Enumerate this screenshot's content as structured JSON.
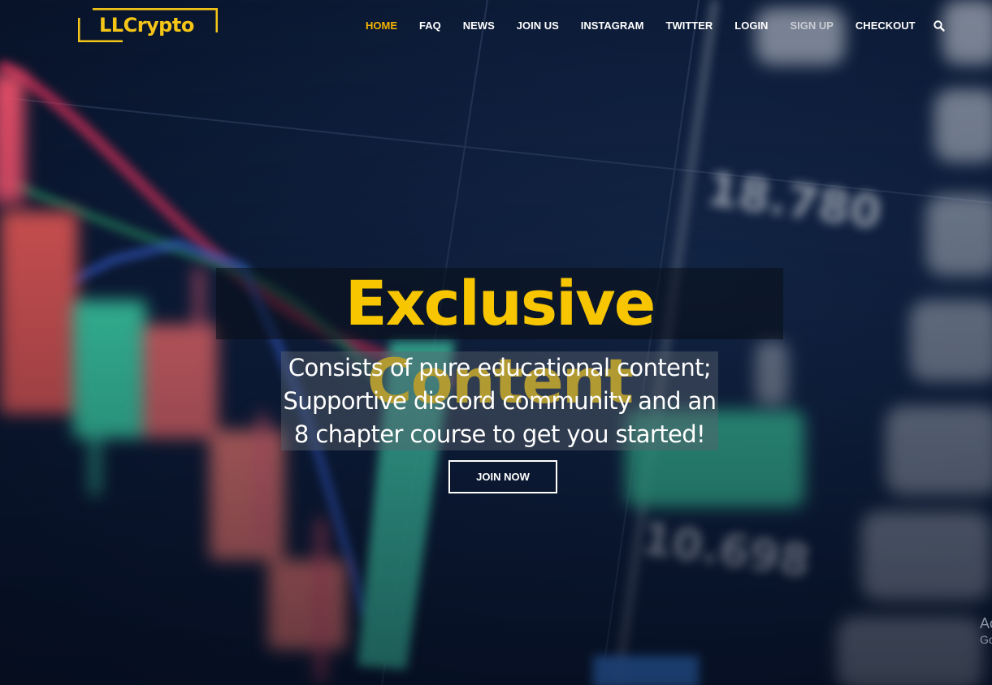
{
  "brand": {
    "logo_text": "LLCrypto",
    "accent_color": "#f5c518"
  },
  "nav": {
    "items": [
      {
        "label": "HOME",
        "active": true
      },
      {
        "label": "FAQ",
        "active": false
      },
      {
        "label": "NEWS",
        "active": false
      },
      {
        "label": "JOIN US",
        "active": false
      },
      {
        "label": "INSTAGRAM",
        "active": false
      },
      {
        "label": "TWITTER",
        "active": false
      },
      {
        "label": "LOGIN",
        "active": false
      },
      {
        "label": "SIGN UP",
        "active": false
      },
      {
        "label": "CHECKOUT",
        "active": false
      }
    ],
    "search_icon": "search-icon",
    "active_color": "#f5b400"
  },
  "hero": {
    "headline": "Exclusive Content",
    "headline_color": "#f7c600",
    "subtitle_lines": [
      "Consists of pure educational content;",
      "Supportive discord community and an",
      "8 chapter course to get you started!"
    ],
    "cta_label": "JOIN NOW"
  },
  "background": {
    "ticker_values": [
      "18.780",
      "10.698"
    ]
  },
  "corner": {
    "line1": "Ac",
    "line2": "Go"
  }
}
